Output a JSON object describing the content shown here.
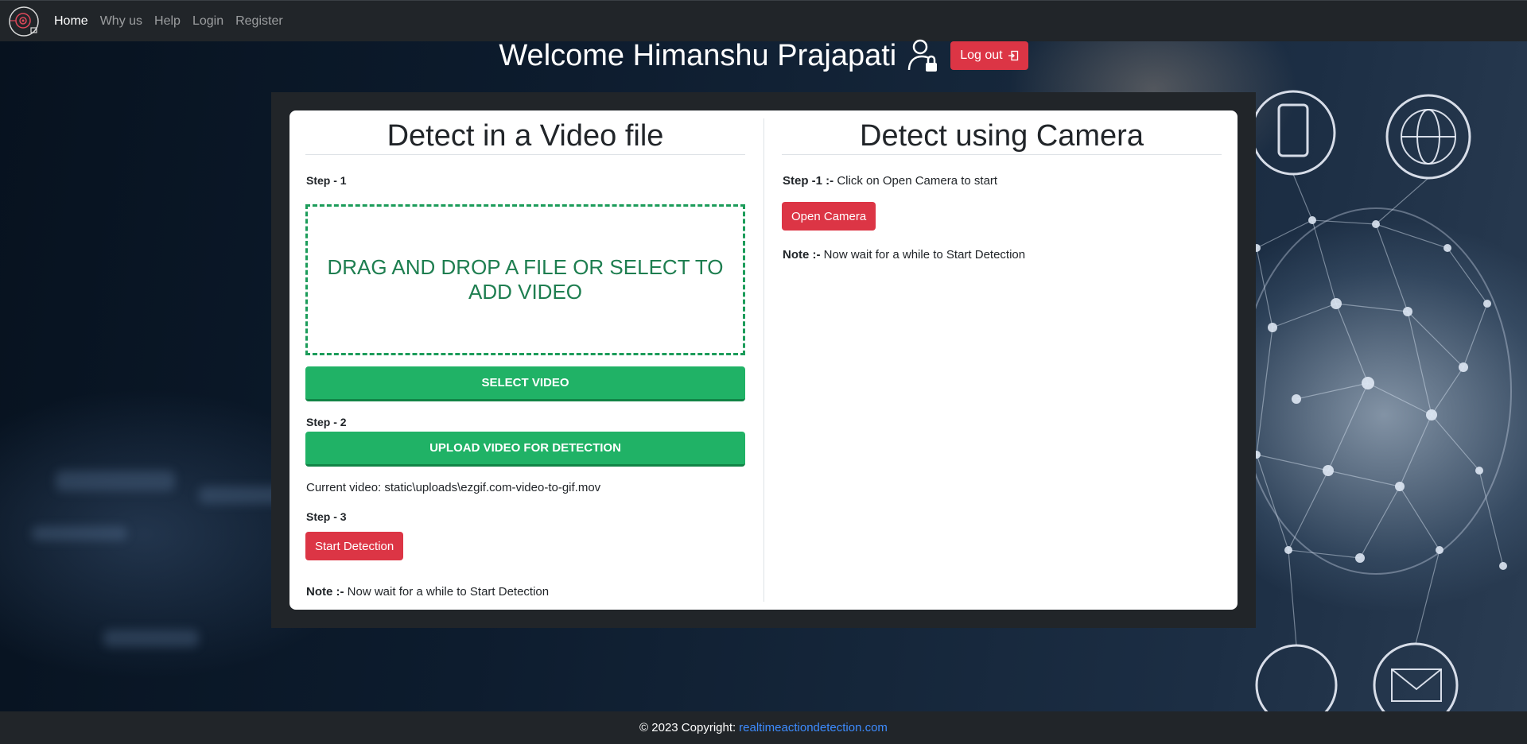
{
  "navbar": {
    "logo_icon": "eye-camera-logo-icon",
    "links": [
      {
        "label": "Home",
        "active": true
      },
      {
        "label": "Why us",
        "active": false
      },
      {
        "label": "Help",
        "active": false
      },
      {
        "label": "Login",
        "active": false
      },
      {
        "label": "Register",
        "active": false
      }
    ]
  },
  "header": {
    "welcome_text": "Welcome Himanshu Prajapati",
    "user_icon": "user-lock-icon",
    "logout_label": "Log out",
    "logout_icon": "box-arrow-in-right-icon"
  },
  "video_section": {
    "title": "Detect in a Video file",
    "step1_label": "Step - 1",
    "dropzone_text": "DRAG AND DROP A FILE OR SELECT TO ADD VIDEO",
    "select_button": "SELECT VIDEO",
    "step2_label": "Step - 2",
    "upload_button": "UPLOAD VIDEO FOR DETECTION",
    "current_video_label": "Current video:",
    "current_video_value": "static\\uploads\\ezgif.com-video-to-gif.mov",
    "step3_label": "Step - 3",
    "start_button": "Start Detection",
    "note_label": "Note :-",
    "note_text": "Now wait for a while to Start Detection"
  },
  "camera_section": {
    "title": "Detect using Camera",
    "step1_label": "Step -1 :-",
    "step1_text": "Click on Open Camera to start",
    "open_button": "Open Camera",
    "note_label": "Note :-",
    "note_text": "Now wait for a while to Start Detection"
  },
  "footer": {
    "copyright": "© 2023 Copyright:",
    "link_text": "realtimeactiondetection.com"
  },
  "colors": {
    "navbar_bg": "#212529",
    "danger": "#dc3545",
    "success": "#20b266",
    "link": "#3d8bfd"
  }
}
